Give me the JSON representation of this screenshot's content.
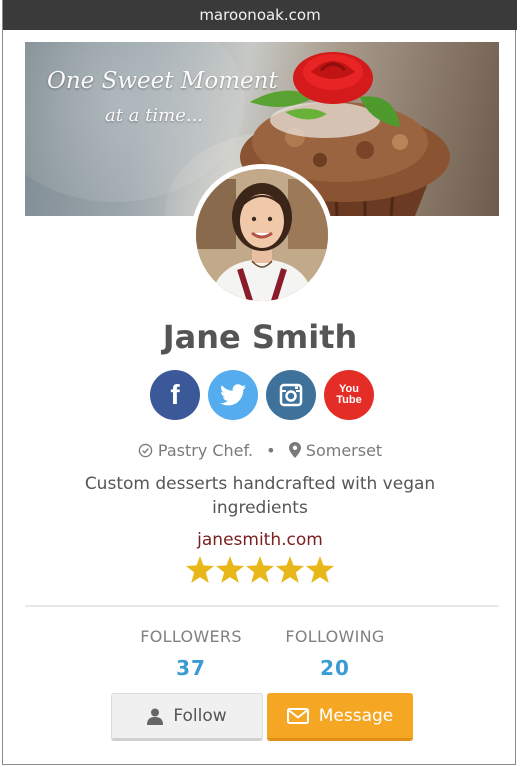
{
  "browser": {
    "url": "maroonoak.com"
  },
  "cover": {
    "tagline_line1": "One Sweet Moment",
    "tagline_line2": "at a time..."
  },
  "profile": {
    "name": "Jane Smith",
    "role": "Pastry Chef.",
    "location": "Somerset",
    "bio": "Custom desserts handcrafted with vegan ingredients",
    "website": "janesmith.com",
    "rating": 5,
    "rating_max": 5
  },
  "socials": [
    {
      "name": "facebook",
      "label": "f",
      "color": "#3b5998"
    },
    {
      "name": "twitter",
      "color": "#55acee"
    },
    {
      "name": "instagram",
      "color": "#3f729b"
    },
    {
      "name": "youtube",
      "label": "You Tube",
      "color": "#e52d27"
    }
  ],
  "stats": {
    "followers_label": "FOLLOWERS",
    "followers_value": "37",
    "following_label": "FOLLOWING",
    "following_value": "20"
  },
  "actions": {
    "follow_label": "Follow",
    "message_label": "Message"
  },
  "colors": {
    "accent_orange": "#f5a623",
    "stat_blue": "#3a9bd5",
    "star_gold": "#e8b71a",
    "website_maroon": "#7a2020"
  }
}
